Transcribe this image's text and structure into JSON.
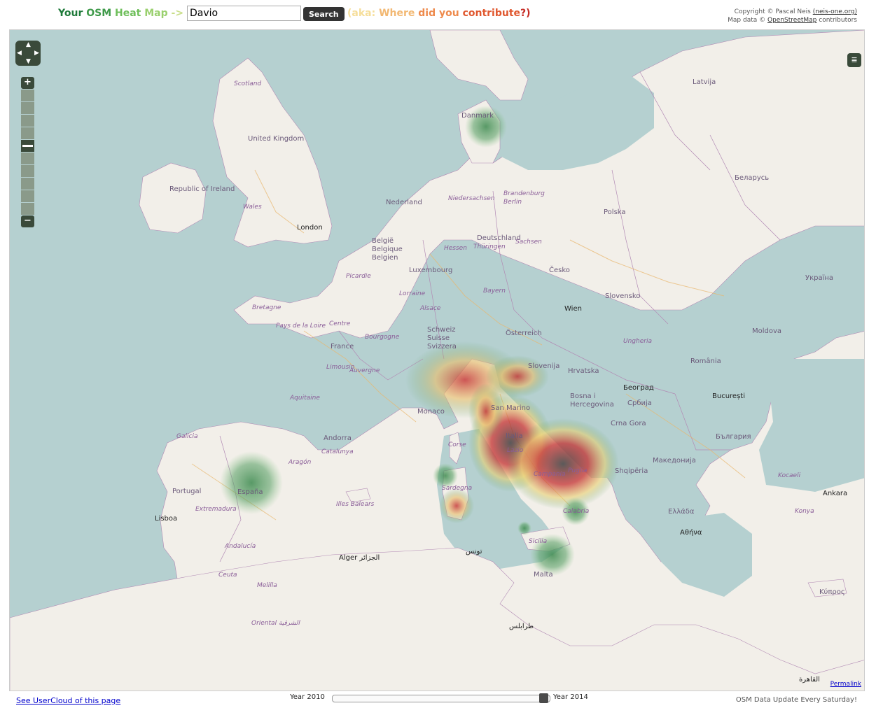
{
  "header": {
    "title_parts": [
      "Your",
      "OSM",
      "Heat",
      "Map",
      "->"
    ],
    "username_value": "Davio",
    "search_label": "Search",
    "aka_parts": [
      "(aka:",
      "Where",
      "did you",
      "contribute",
      "?)"
    ],
    "copyright_line1_prefix": "Copyright © Pascal Neis",
    "copyright_link": "(neis-one.org)",
    "copyright_line2_prefix": "Map data ©",
    "osm_link": "OpenStreetMap",
    "copyright_line2_suffix": "contributors"
  },
  "map": {
    "labels": [
      {
        "text": "Scotland",
        "kind": "region"
      },
      {
        "text": "United Kingdom",
        "kind": "country"
      },
      {
        "text": "Republic of Ireland",
        "kind": "country"
      },
      {
        "text": "Wales",
        "kind": "region"
      },
      {
        "text": "London",
        "kind": "capital"
      },
      {
        "text": "Danmark",
        "kind": "country"
      },
      {
        "text": "Nederland",
        "kind": "country"
      },
      {
        "text": "België Belgique Belgien",
        "kind": "country"
      },
      {
        "text": "Luxembourg",
        "kind": "country"
      },
      {
        "text": "Deutschland",
        "kind": "country"
      },
      {
        "text": "Polska",
        "kind": "country"
      },
      {
        "text": "Česko",
        "kind": "country"
      },
      {
        "text": "Slovensko",
        "kind": "country"
      },
      {
        "text": "Wien",
        "kind": "capital"
      },
      {
        "text": "Österreich",
        "kind": "country"
      },
      {
        "text": "Schweiz Suisse Svizzera",
        "kind": "country"
      },
      {
        "text": "France",
        "kind": "country"
      },
      {
        "text": "Bretagne",
        "kind": "region"
      },
      {
        "text": "Monaco",
        "kind": "country"
      },
      {
        "text": "España",
        "kind": "country"
      },
      {
        "text": "Portugal",
        "kind": "country"
      },
      {
        "text": "Lisboa",
        "kind": "capital"
      },
      {
        "text": "Andorra",
        "kind": "country"
      },
      {
        "text": "Catalunya",
        "kind": "region"
      },
      {
        "text": "Illes Balears",
        "kind": "region"
      },
      {
        "text": "Sardegna",
        "kind": "region"
      },
      {
        "text": "Corse",
        "kind": "region"
      },
      {
        "text": "Italia",
        "kind": "country"
      },
      {
        "text": "Lazio",
        "kind": "region"
      },
      {
        "text": "Campania",
        "kind": "region"
      },
      {
        "text": "Puglia",
        "kind": "region"
      },
      {
        "text": "Calabria",
        "kind": "region"
      },
      {
        "text": "Sicilia",
        "kind": "region"
      },
      {
        "text": "Malta",
        "kind": "country"
      },
      {
        "text": "San Marino",
        "kind": "country"
      },
      {
        "text": "Slovenija",
        "kind": "country"
      },
      {
        "text": "Hrvatska",
        "kind": "country"
      },
      {
        "text": "Bosna i Hercegovina",
        "kind": "country"
      },
      {
        "text": "Србија",
        "kind": "country"
      },
      {
        "text": "Београд",
        "kind": "capital"
      },
      {
        "text": "Crna Gora",
        "kind": "country"
      },
      {
        "text": "Shqipëria",
        "kind": "country"
      },
      {
        "text": "Македонија",
        "kind": "country"
      },
      {
        "text": "Ελλάδα",
        "kind": "country"
      },
      {
        "text": "Αθήνα",
        "kind": "capital"
      },
      {
        "text": "România",
        "kind": "country"
      },
      {
        "text": "București",
        "kind": "capital"
      },
      {
        "text": "България",
        "kind": "country"
      },
      {
        "text": "Moldova",
        "kind": "country"
      },
      {
        "text": "Україна",
        "kind": "country"
      },
      {
        "text": "Беларусь",
        "kind": "country"
      },
      {
        "text": "Latvija",
        "kind": "country"
      },
      {
        "text": "Ankara",
        "kind": "capital"
      },
      {
        "text": "Κύπρος",
        "kind": "country"
      },
      {
        "text": "Alger ‎الجزائر‎",
        "kind": "capital"
      },
      {
        "text": "تونس",
        "kind": "capital"
      },
      {
        "text": "طرابلس",
        "kind": "capital"
      },
      {
        "text": "القاهرة",
        "kind": "capital"
      },
      {
        "text": "Oriental الشرقية",
        "kind": "region"
      },
      {
        "text": "Melilla",
        "kind": "region"
      },
      {
        "text": "Ceuta",
        "kind": "region"
      },
      {
        "text": "Andalucía",
        "kind": "region"
      },
      {
        "text": "Extremadura",
        "kind": "region"
      },
      {
        "text": "Galicia",
        "kind": "region"
      },
      {
        "text": "Aragón",
        "kind": "region"
      },
      {
        "text": "Auvergne",
        "kind": "region"
      },
      {
        "text": "Aquitaine",
        "kind": "region"
      },
      {
        "text": "Limousin",
        "kind": "region"
      },
      {
        "text": "Bourgogne",
        "kind": "region"
      },
      {
        "text": "Centre",
        "kind": "region"
      },
      {
        "text": "Bayern",
        "kind": "region"
      },
      {
        "text": "Sachsen",
        "kind": "region"
      },
      {
        "text": "Hessen",
        "kind": "region"
      },
      {
        "text": "Thüringen",
        "kind": "region"
      },
      {
        "text": "Niedersachsen",
        "kind": "region"
      },
      {
        "text": "Brandenburg Berlin",
        "kind": "region"
      },
      {
        "text": "Pays de la Loire",
        "kind": "region"
      },
      {
        "text": "Picardie",
        "kind": "region"
      },
      {
        "text": "Lorraine",
        "kind": "region"
      },
      {
        "text": "Alsace",
        "kind": "region"
      },
      {
        "text": "Ungheria",
        "kind": "region"
      },
      {
        "text": "Kocaeli",
        "kind": "region"
      },
      {
        "text": "Konya",
        "kind": "region"
      }
    ],
    "heat_spots": [
      {
        "name": "danmark",
        "level": 0.3
      },
      {
        "name": "spain",
        "level": 0.35
      },
      {
        "name": "north-italy",
        "level": 0.75
      },
      {
        "name": "central-italy",
        "level": 1.0
      },
      {
        "name": "south-italy",
        "level": 0.95
      },
      {
        "name": "sardegna-north",
        "level": 0.3
      },
      {
        "name": "sardegna-south",
        "level": 0.5
      },
      {
        "name": "calabria",
        "level": 0.35
      },
      {
        "name": "malta",
        "level": 0.35
      }
    ],
    "controls": {
      "zoom_in": "+",
      "zoom_out": "−",
      "zoom_level": 6,
      "zoom_levels": 10,
      "permalink": "Permalink"
    }
  },
  "footer": {
    "usercloud_link": "See UserCloud of this page",
    "year_start": "Year 2010",
    "year_end": "Year 2014",
    "slider_value": 2014,
    "update_note": "OSM Data Update Every Saturday!"
  },
  "colors": {
    "sea": "#b5d0d0",
    "land": "#f2efe9",
    "border": "#b28ab4",
    "heat_green": "#5ea36a",
    "heat_red": "#d02b2b",
    "heat_dark": "#555555"
  }
}
